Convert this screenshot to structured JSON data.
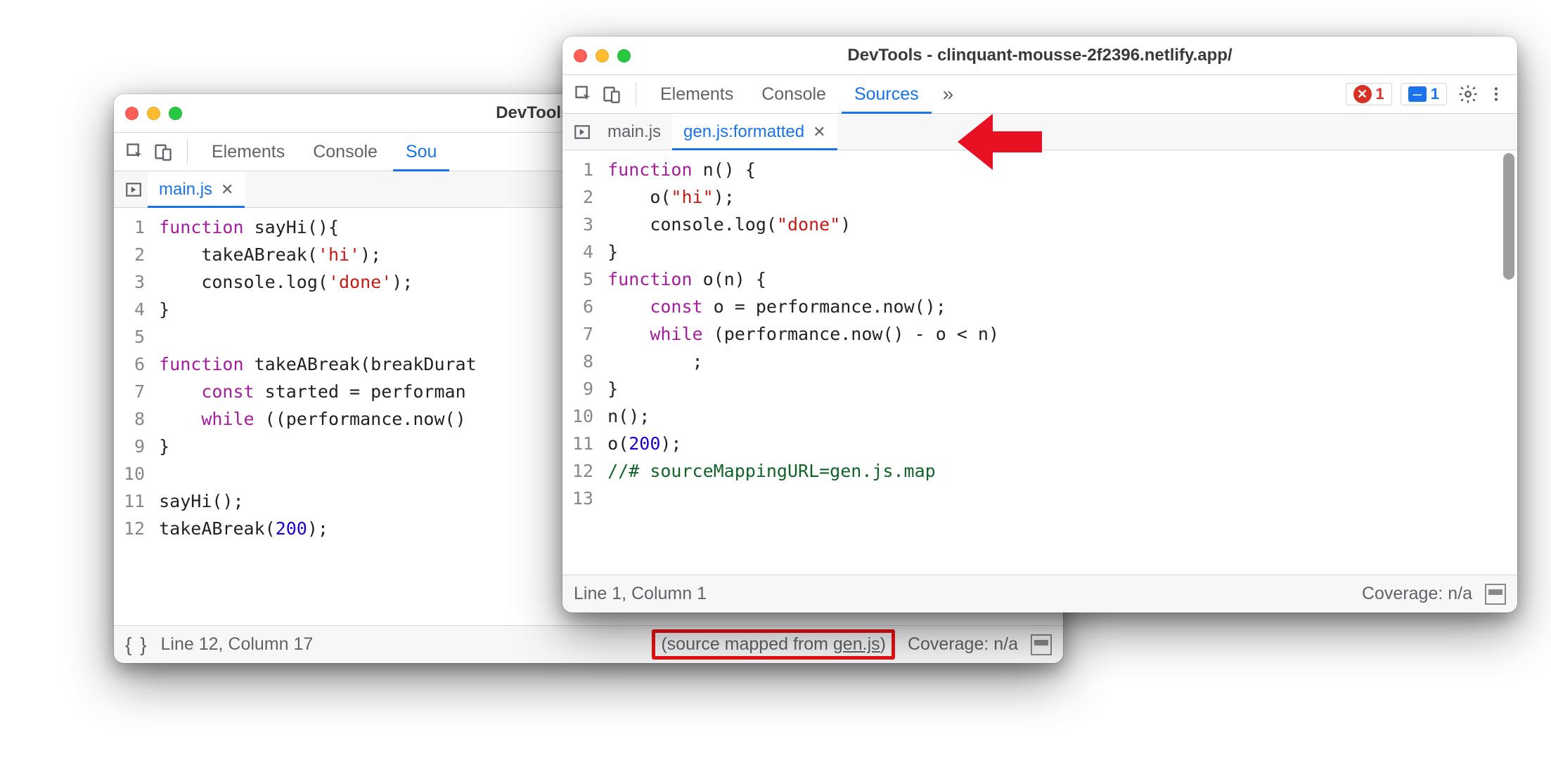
{
  "windows": {
    "left": {
      "title": "DevTools - clinquant-m",
      "panel_tabs": [
        "Elements",
        "Console",
        "Sou"
      ],
      "active_panel": "Sou",
      "file_tabs": [
        {
          "label": "main.js",
          "active": true
        }
      ],
      "code_lines": [
        {
          "n": 1,
          "tokens": [
            {
              "t": "function",
              "c": "kw"
            },
            {
              "t": " sayHi(){",
              "c": ""
            }
          ]
        },
        {
          "n": 2,
          "tokens": [
            {
              "t": "    takeABreak(",
              "c": ""
            },
            {
              "t": "'hi'",
              "c": "str"
            },
            {
              "t": ");",
              "c": ""
            }
          ]
        },
        {
          "n": 3,
          "tokens": [
            {
              "t": "    console.log(",
              "c": ""
            },
            {
              "t": "'done'",
              "c": "str"
            },
            {
              "t": ");",
              "c": ""
            }
          ]
        },
        {
          "n": 4,
          "tokens": [
            {
              "t": "}",
              "c": ""
            }
          ]
        },
        {
          "n": 5,
          "tokens": [
            {
              "t": "",
              "c": ""
            }
          ]
        },
        {
          "n": 6,
          "tokens": [
            {
              "t": "function",
              "c": "kw"
            },
            {
              "t": " takeABreak(breakDurat",
              "c": ""
            }
          ]
        },
        {
          "n": 7,
          "tokens": [
            {
              "t": "    ",
              "c": ""
            },
            {
              "t": "const",
              "c": "kw"
            },
            {
              "t": " started = performan",
              "c": ""
            }
          ]
        },
        {
          "n": 8,
          "tokens": [
            {
              "t": "    ",
              "c": ""
            },
            {
              "t": "while",
              "c": "kw"
            },
            {
              "t": " ((performance.now()",
              "c": ""
            }
          ]
        },
        {
          "n": 9,
          "tokens": [
            {
              "t": "}",
              "c": ""
            }
          ]
        },
        {
          "n": 10,
          "tokens": [
            {
              "t": "",
              "c": ""
            }
          ]
        },
        {
          "n": 11,
          "tokens": [
            {
              "t": "sayHi();",
              "c": ""
            }
          ]
        },
        {
          "n": 12,
          "tokens": [
            {
              "t": "takeABreak(",
              "c": ""
            },
            {
              "t": "200",
              "c": "num"
            },
            {
              "t": ");",
              "c": ""
            }
          ]
        }
      ],
      "status": {
        "cursor": "Line 12, Column 17",
        "source_mapped_prefix": "(source mapped from ",
        "source_mapped_link": "gen.js",
        "source_mapped_suffix": ")",
        "coverage": "Coverage: n/a"
      }
    },
    "right": {
      "title": "DevTools - clinquant-mousse-2f2396.netlify.app/",
      "panel_tabs": [
        "Elements",
        "Console",
        "Sources"
      ],
      "active_panel": "Sources",
      "errors": "1",
      "messages": "1",
      "file_tabs": [
        {
          "label": "main.js",
          "active": false
        },
        {
          "label": "gen.js:formatted",
          "active": true
        }
      ],
      "code_lines": [
        {
          "n": 1,
          "tokens": [
            {
              "t": "function",
              "c": "kw"
            },
            {
              "t": " n() {",
              "c": ""
            }
          ]
        },
        {
          "n": 2,
          "tokens": [
            {
              "t": "    o(",
              "c": ""
            },
            {
              "t": "\"hi\"",
              "c": "str"
            },
            {
              "t": ");",
              "c": ""
            }
          ]
        },
        {
          "n": 3,
          "tokens": [
            {
              "t": "    console.log(",
              "c": ""
            },
            {
              "t": "\"done\"",
              "c": "str"
            },
            {
              "t": ")",
              "c": ""
            }
          ]
        },
        {
          "n": 4,
          "tokens": [
            {
              "t": "}",
              "c": ""
            }
          ]
        },
        {
          "n": 5,
          "tokens": [
            {
              "t": "function",
              "c": "kw"
            },
            {
              "t": " o(n) {",
              "c": ""
            }
          ]
        },
        {
          "n": 6,
          "tokens": [
            {
              "t": "    ",
              "c": ""
            },
            {
              "t": "const",
              "c": "kw"
            },
            {
              "t": " o = performance.now();",
              "c": ""
            }
          ]
        },
        {
          "n": 7,
          "tokens": [
            {
              "t": "    ",
              "c": ""
            },
            {
              "t": "while",
              "c": "kw"
            },
            {
              "t": " (performance.now() - o < n)",
              "c": ""
            }
          ]
        },
        {
          "n": 8,
          "tokens": [
            {
              "t": "        ;",
              "c": ""
            }
          ]
        },
        {
          "n": 9,
          "tokens": [
            {
              "t": "}",
              "c": ""
            }
          ]
        },
        {
          "n": 10,
          "tokens": [
            {
              "t": "n();",
              "c": ""
            }
          ]
        },
        {
          "n": 11,
          "tokens": [
            {
              "t": "o(",
              "c": ""
            },
            {
              "t": "200",
              "c": "num"
            },
            {
              "t": ");",
              "c": ""
            }
          ]
        },
        {
          "n": 12,
          "tokens": [
            {
              "t": "//# sourceMappingURL=gen.js.map",
              "c": "cmt"
            }
          ]
        },
        {
          "n": 13,
          "tokens": [
            {
              "t": "",
              "c": ""
            }
          ]
        }
      ],
      "status": {
        "cursor": "Line 1, Column 1",
        "coverage": "Coverage: n/a"
      }
    }
  }
}
